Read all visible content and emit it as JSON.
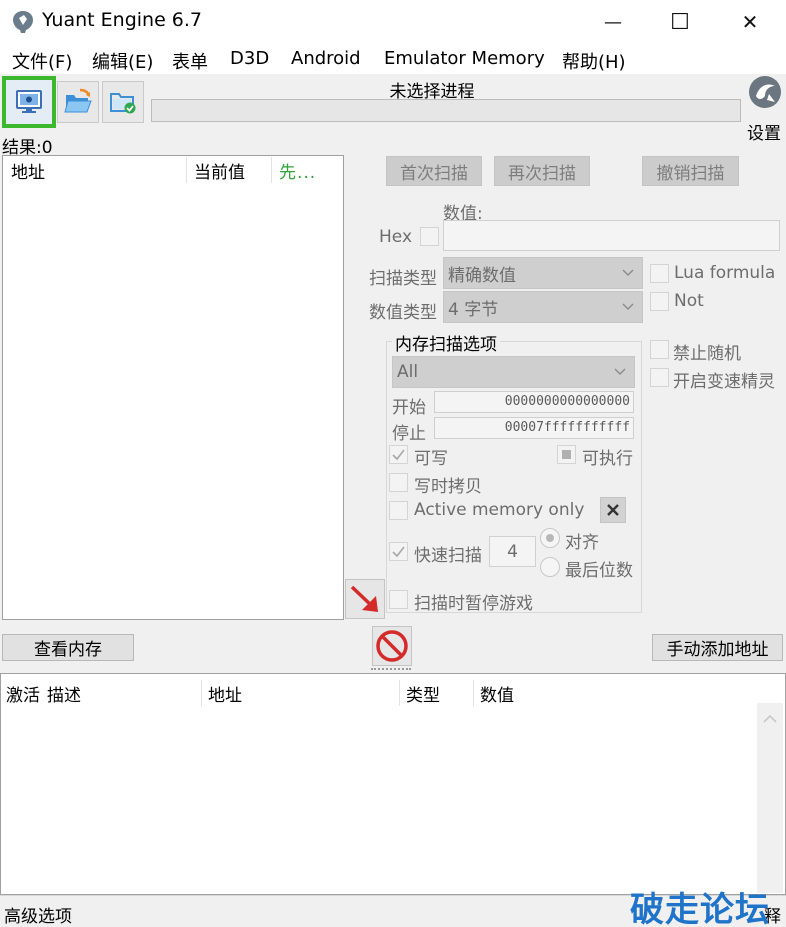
{
  "window": {
    "title": "Yuant Engine 6.7",
    "controls": {
      "minimize": "—",
      "maximize": "☐",
      "close": "✕"
    }
  },
  "menu": [
    "文件(F)",
    "编辑(E)",
    "表单",
    "D3D",
    "Android",
    "Emulator Memory",
    "帮助(H)"
  ],
  "toolbar": {
    "process_label": "未选择进程",
    "settings_label": "设置"
  },
  "results": {
    "label": "结果:0"
  },
  "found_list": {
    "columns": [
      "地址",
      "当前值",
      "先..."
    ]
  },
  "scan_buttons": {
    "first": "首次扫描",
    "next": "再次扫描",
    "undo": "撤销扫描"
  },
  "value": {
    "label": "数值:",
    "hex_label": "Hex"
  },
  "scan_type": {
    "label": "扫描类型",
    "selected": "精确数值"
  },
  "value_type": {
    "label": "数值类型",
    "selected": "4 字节"
  },
  "options_right": {
    "lua_formula": "Lua formula",
    "not": "Not",
    "no_random": "禁止随机",
    "speedhack": "开启变速精灵"
  },
  "memory_scan": {
    "title": "内存扫描选项",
    "region": "All",
    "start_label": "开始",
    "start_value": "0000000000000000",
    "stop_label": "停止",
    "stop_value": "00007fffffffffff",
    "writable": "可写",
    "executable": "可执行",
    "copy_on_write": "写时拷贝",
    "active_memory_only": "Active memory only",
    "fast_scan": "快速扫描",
    "fast_scan_value": "4",
    "align": "对齐",
    "last_digits": "最后位数",
    "pause_game": "扫描时暂停游戏"
  },
  "bottom_buttons": {
    "view_memory": "查看内存",
    "add_address": "手动添加地址"
  },
  "address_table": {
    "columns": [
      "激活",
      "描述",
      "地址",
      "类型",
      "数值"
    ]
  },
  "status": {
    "advanced": "高级选项",
    "right_partial": "释"
  },
  "watermark": "破走论坛",
  "colors": {
    "highlight_border": "#3cb82e",
    "disabled_button": "#cccccc",
    "stop_icon": "#d42a2a",
    "arrow": "#d42a2a",
    "watermark": "#1f74c9"
  }
}
